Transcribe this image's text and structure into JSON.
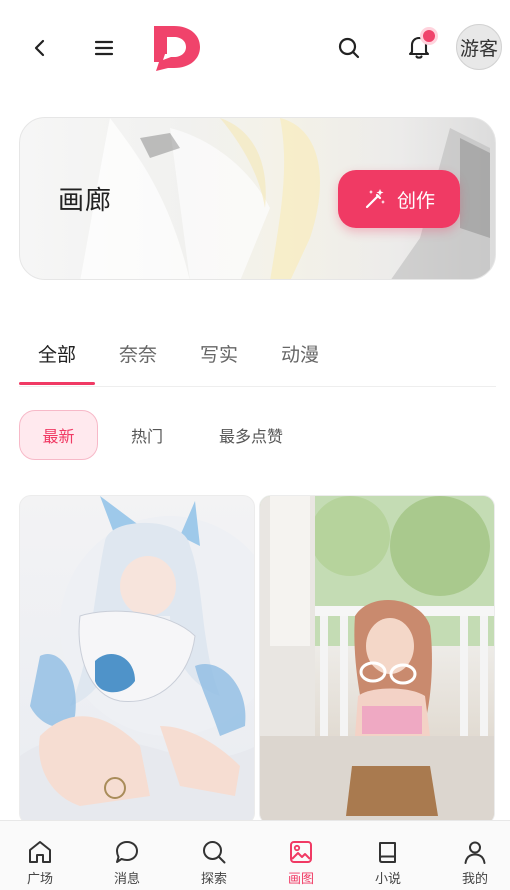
{
  "header": {
    "guest_label": "游客",
    "icons": [
      "back-icon",
      "menu-icon",
      "logo",
      "search-icon",
      "bell-icon"
    ]
  },
  "banner": {
    "title": "画廊",
    "create_label": "创作"
  },
  "tabs": [
    {
      "label": "全部",
      "active": true
    },
    {
      "label": "奈奈",
      "active": false
    },
    {
      "label": "写实",
      "active": false
    },
    {
      "label": "动漫",
      "active": false
    }
  ],
  "sort": [
    {
      "label": "最新",
      "active": true
    },
    {
      "label": "热门",
      "active": false
    },
    {
      "label": "最多点赞",
      "active": false
    }
  ],
  "bottom_nav": [
    {
      "label": "广场",
      "icon": "home-icon",
      "active": false
    },
    {
      "label": "消息",
      "icon": "chat-icon",
      "active": false
    },
    {
      "label": "探索",
      "icon": "search-icon",
      "active": false
    },
    {
      "label": "画图",
      "icon": "image-icon",
      "active": true
    },
    {
      "label": "小说",
      "icon": "book-icon",
      "active": false
    },
    {
      "label": "我的",
      "icon": "user-icon",
      "active": false
    }
  ],
  "colors": {
    "accent": "#f03a64",
    "accent_light": "#ffe9ee"
  }
}
